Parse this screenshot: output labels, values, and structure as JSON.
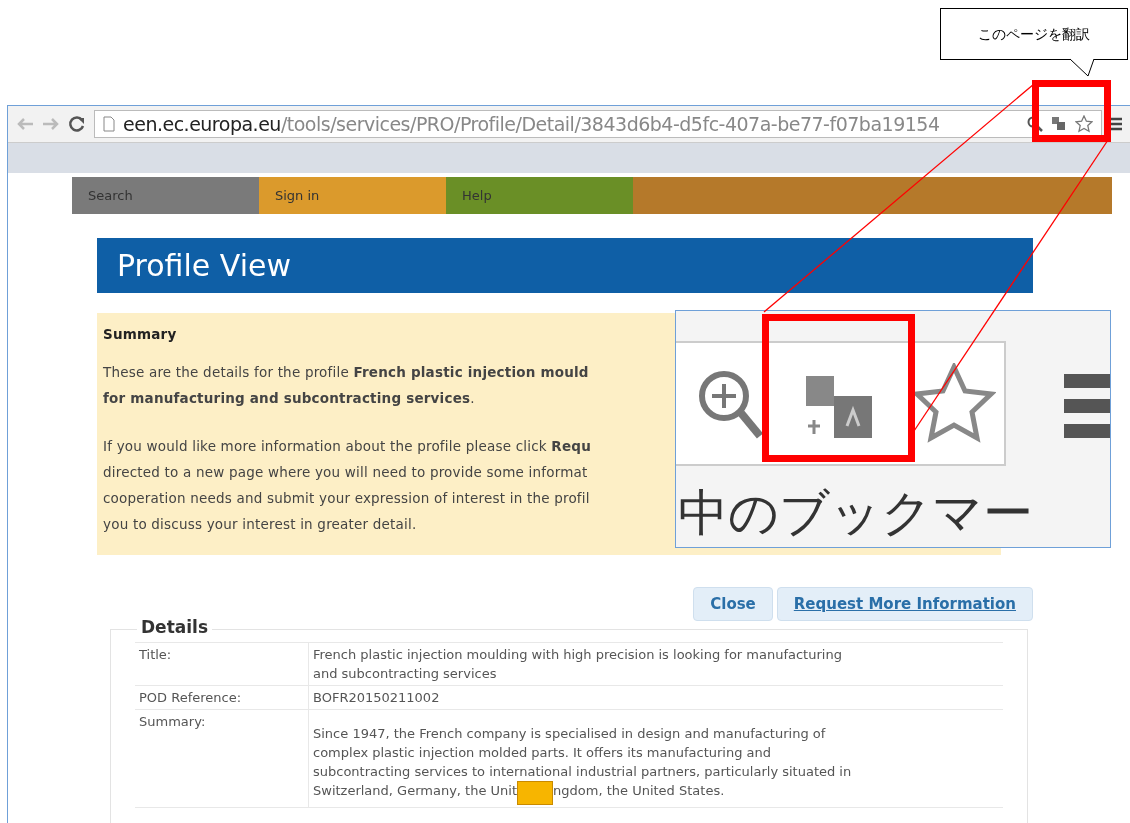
{
  "callout": {
    "text": "このページを翻訳"
  },
  "browser": {
    "url_host": "een.ec.europa.eu",
    "url_path": "/tools/services/PRO/Profile/Detail/3843d6b4-d5fc-407a-be77-f07ba19154"
  },
  "nav": [
    {
      "label": "Search",
      "color": "#7a7a7a"
    },
    {
      "label": "Sign in",
      "color": "#db9a2c"
    },
    {
      "label": "Help",
      "color": "#6a8f26"
    },
    {
      "color": "#b5792a"
    }
  ],
  "page_title": "Profile View",
  "summary": {
    "heading": "Summary",
    "paragraphs": [
      "These are the details for the profile **French plastic injection mould**\n**for manufacturing and subcontracting services**.",
      "If you would like more information about the profile please click **Requ**\ndirected to a new page where you will need to provide some informat\ncooperation needs and submit your expression of interest in the profil\nyou to discuss your interest in greater detail."
    ]
  },
  "inset": {
    "text": "中のブックマー"
  },
  "buttons": [
    {
      "label": "Close",
      "kind": "button"
    },
    {
      "label": "Request More Information",
      "kind": "link"
    }
  ],
  "details": {
    "legend": "Details",
    "rows": [
      {
        "label": "Title:",
        "value": [
          "French plastic injection moulding with high precision is looking for manufacturing\nand subcontracting services"
        ]
      },
      {
        "label": "POD Reference:",
        "value": [
          "BOFR20150211002"
        ]
      },
      {
        "label": "Summary:",
        "value": [
          "Since 1947, the French company is specialised in design and manufacturing of\ncomplex plastic injection molded parts. It offers its manufacturing and\nsubcontracting services to international industrial partners, particularly situated in",
          "Switzerland, Germany, the Unit",
          "ngdom, the United States."
        ]
      }
    ]
  }
}
